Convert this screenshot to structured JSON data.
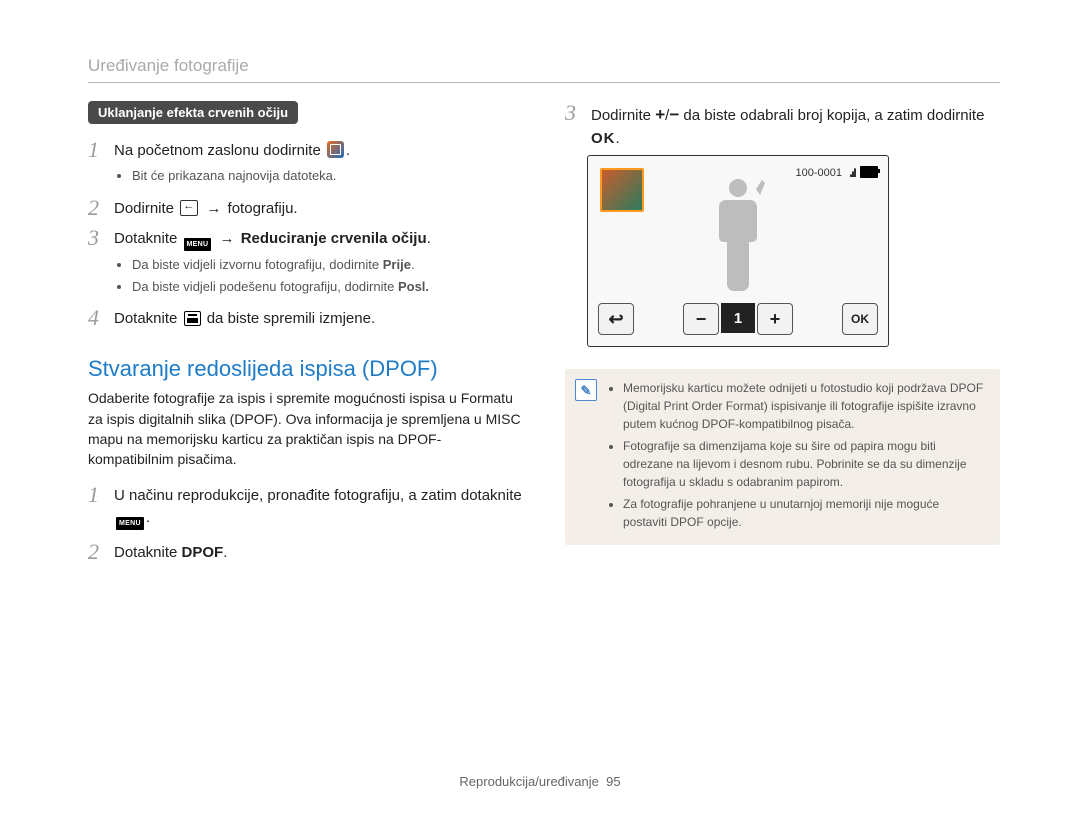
{
  "page_header": "Uređivanje fotografije",
  "left": {
    "tag": "Uklanjanje efekta crvenih očiju",
    "steps": {
      "s1": {
        "num": "1",
        "text_a": "Na početnom zaslonu dodirnite ",
        "bullet": "Bit će prikazana najnovija datoteka."
      },
      "s2": {
        "num": "2",
        "text_a": "Dodirnite ",
        "arrow": "→",
        "text_b": " fotografiju."
      },
      "s3": {
        "num": "3",
        "text_a": "Dotaknite ",
        "menu_label": "MENU",
        "arrow": "→",
        "text_b": " Reduciranje crvenila očiju",
        "bullet1_a": "Da biste vidjeli izvornu fotografiju, dodirnite ",
        "bullet1_b": "Prije",
        "bullet2_a": "Da biste vidjeli podešenu fotografiju, dodirnite ",
        "bullet2_b": "Posl."
      },
      "s4": {
        "num": "4",
        "text_a": "Dotaknite ",
        "text_b": " da biste spremili izmjene."
      }
    },
    "section_heading": "Stvaranje redoslijeda ispisa (DPOF)",
    "section_desc": "Odaberite fotografije za ispis i spremite mogućnosti ispisa u Formatu za ispis digitalnih slika (DPOF). Ova informacija je spremljena u MISC mapu na memorijsku karticu za praktičan ispis na DPOF-kompatibilnim pisačima.",
    "dpof_steps": {
      "s1": {
        "num": "1",
        "text_a": "U načinu reprodukcije, pronađite fotografiju, a zatim dotaknite ",
        "menu_label": "MENU"
      },
      "s2": {
        "num": "2",
        "text_a": "Dotaknite ",
        "bold": "DPOF",
        "period": "."
      }
    }
  },
  "right": {
    "step3": {
      "num": "3",
      "text_a": "Dodirnite ",
      "plus": "+",
      "slash": "/",
      "minus": "−",
      "text_b": " da biste odabrali broj kopija, a zatim dodirnite ",
      "ok": "OK",
      "period": "."
    },
    "screen": {
      "counter": "100-0001",
      "count_value": "1",
      "back_glyph": "↩",
      "minus": "−",
      "plus": "+",
      "ok": "OK"
    },
    "note": {
      "icon": "✎",
      "items": [
        "Memorijsku karticu možete odnijeti u fotostudio koji podržava DPOF (Digital Print Order Format) ispisivanje ili fotografije ispišite izravno putem kućnog DPOF-kompatibilnog pisača.",
        "Fotografije sa dimenzijama koje su šire od papira mogu biti odrezane na lijevom i desnom rubu. Pobrinite se da su dimenzije fotografija u skladu s odabranim papirom.",
        "Za fotografije pohranjene u unutarnjoj memoriji nije moguće postaviti DPOF opcije."
      ]
    }
  },
  "footer": {
    "label": "Reprodukcija/uređivanje",
    "page": "95"
  }
}
